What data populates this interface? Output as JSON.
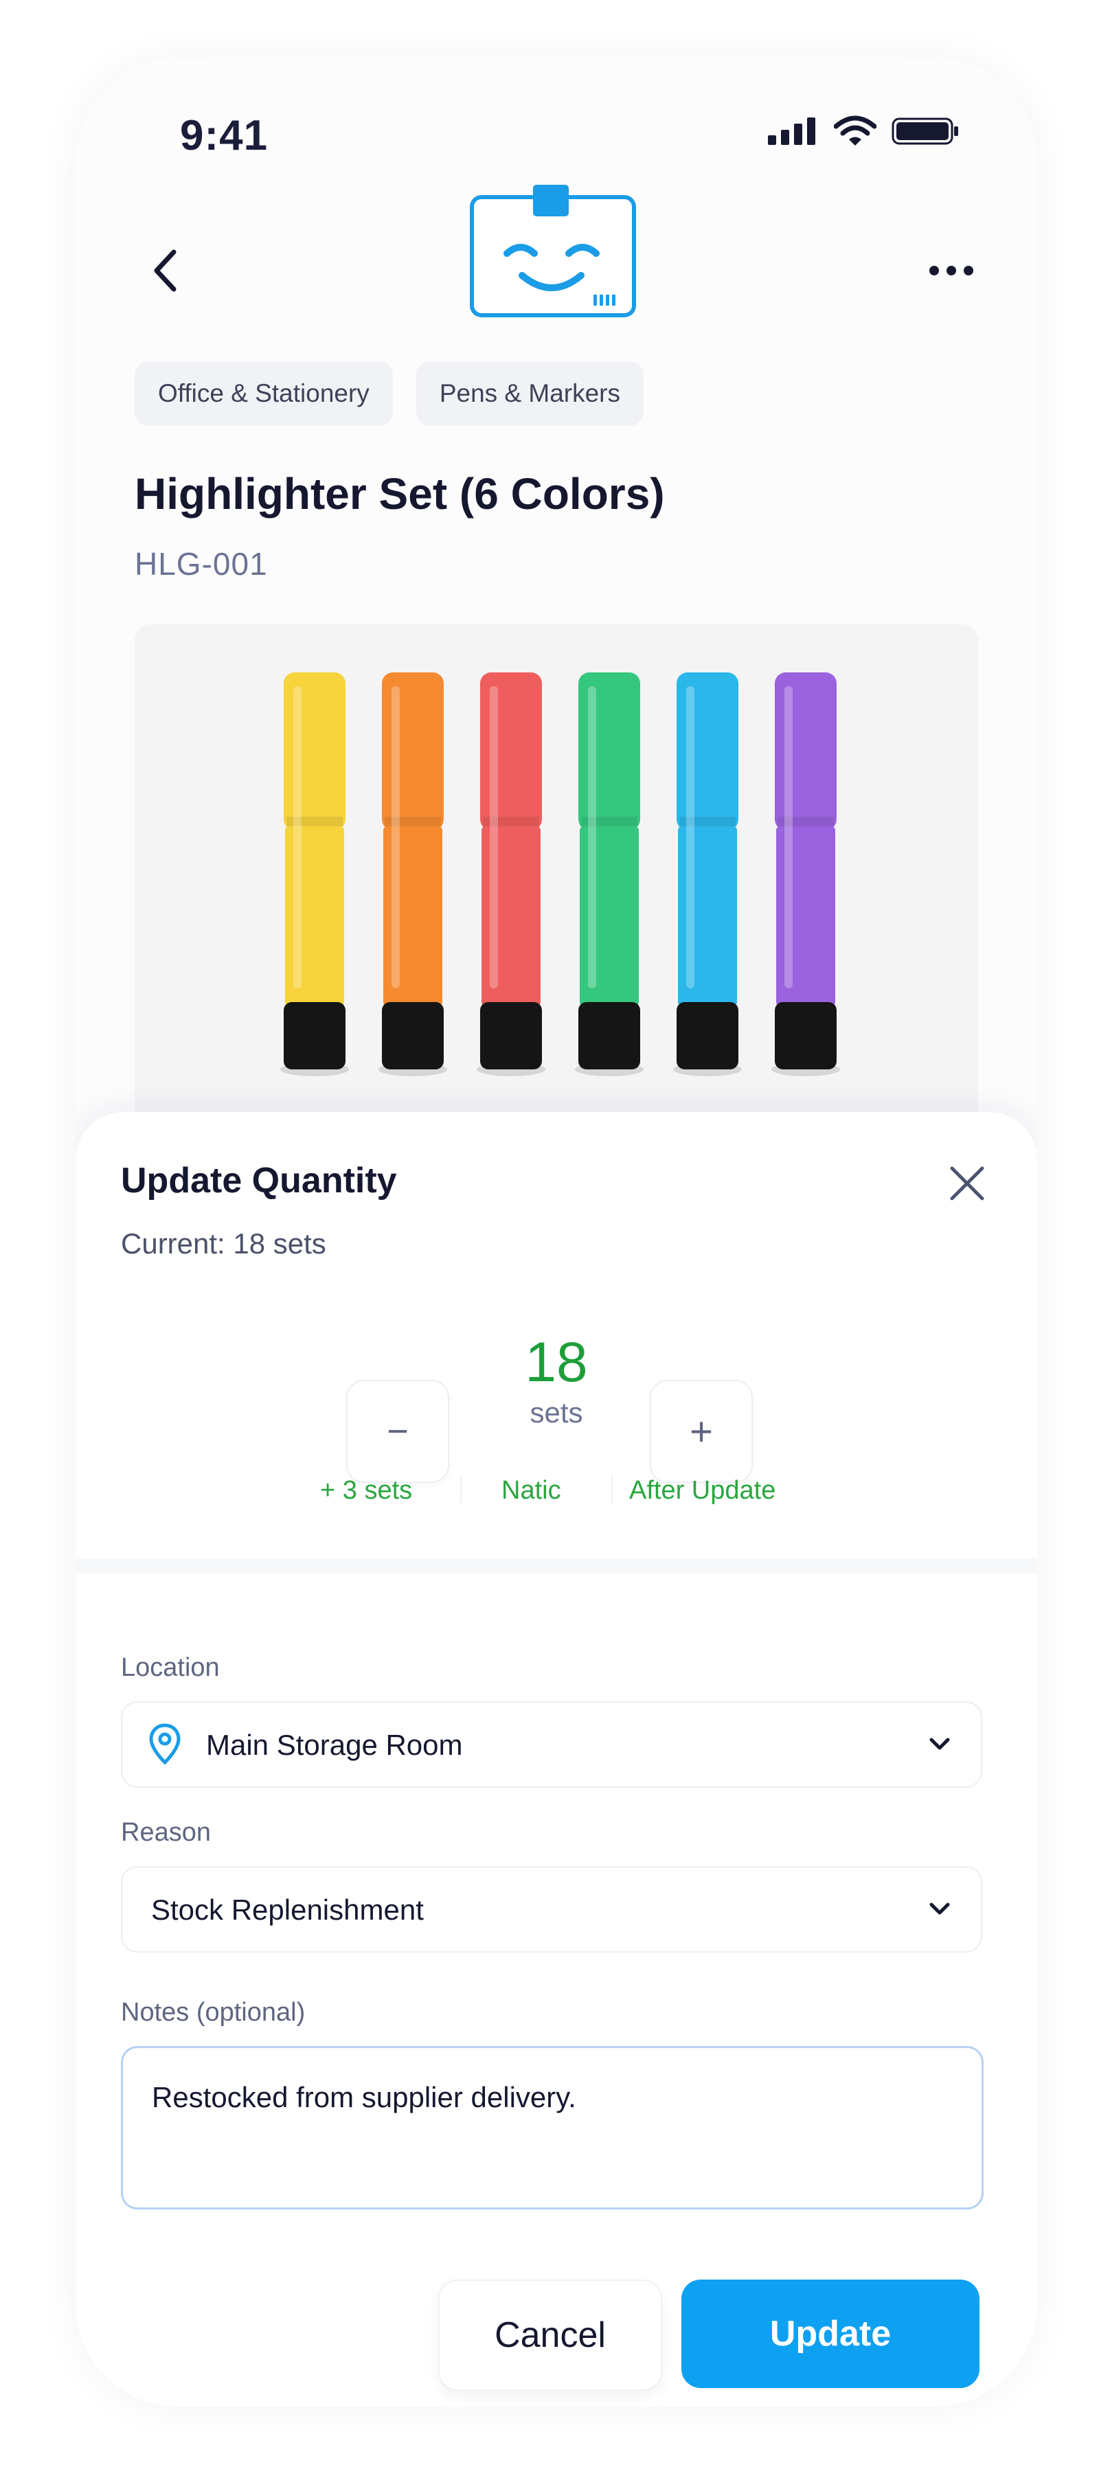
{
  "status_bar": {
    "time": "9:41"
  },
  "breadcrumbs": [
    "Office & Stationery",
    "Pens & Markers"
  ],
  "product": {
    "title": "Highlighter Set (6 Colors)",
    "sku": "HLG-001",
    "marker_colors": [
      "#f7d33c",
      "#f58a30",
      "#ef5e5e",
      "#36c77f",
      "#2bb7ea",
      "#9a62dd"
    ]
  },
  "sheet": {
    "title": "Update Quantity",
    "current": "Current: 18 sets",
    "quantity": {
      "value": "18",
      "unit": "sets",
      "decrement": "−",
      "increment": "+"
    },
    "summary": {
      "change": "+ 3 sets",
      "mid": "Natic",
      "after": "After Update"
    },
    "location": {
      "label": "Location",
      "value": "Main Storage Room"
    },
    "reason": {
      "label": "Reason",
      "value": "Stock Replenishment"
    },
    "notes": {
      "label": "Notes (optional)",
      "value": "Restocked from supplier delivery."
    },
    "actions": {
      "cancel": "Cancel",
      "update": "Update"
    }
  },
  "colors": {
    "accent": "#0ea1f2",
    "positive": "#2aa63f",
    "title": "#15182f"
  }
}
